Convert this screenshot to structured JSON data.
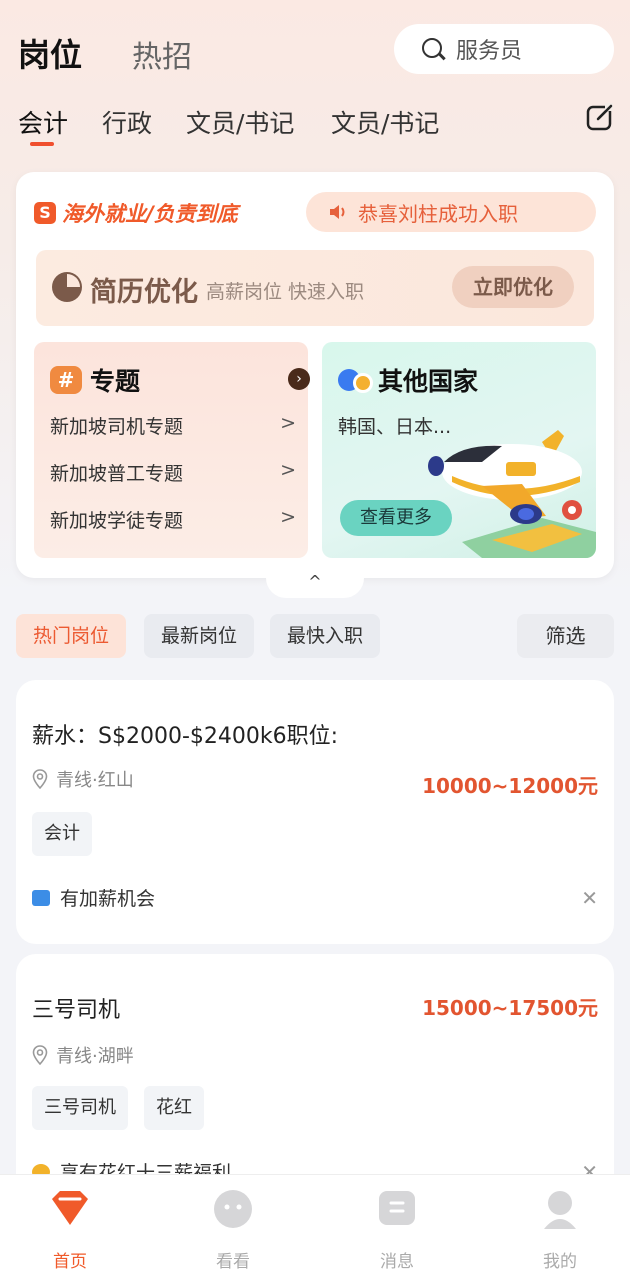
{
  "header": {
    "tab_positions": "岗位",
    "tab_hot": "热招",
    "search_placeholder": "服务员"
  },
  "categories": [
    "会计",
    "行政",
    "文员/书记",
    "文员/书记"
  ],
  "promo": {
    "brand": "海外就业/负责到底",
    "notice": "恭喜刘柱成功入职",
    "resume": {
      "title": "简历优化",
      "subtitle": "高薪岗位 快速入职",
      "button": "立即优化"
    },
    "topic": {
      "title": "专题",
      "items": [
        "新加坡司机专题",
        "新加坡普工专题",
        "新加坡学徒专题"
      ],
      "arrow": ">"
    },
    "country": {
      "title": "其他国家",
      "subtitle": "韩国、日本...",
      "button": "查看更多"
    },
    "collapse": "^"
  },
  "filters": {
    "chips": [
      "热门岗位",
      "最新岗位",
      "最快入职"
    ],
    "filter_button": "筛选"
  },
  "jobs": [
    {
      "title": "薪水：S$2000-$2400k6职位:",
      "location": "青线·红山",
      "salary": "10000~12000元",
      "tags": [
        "会计"
      ],
      "benefit": "有加薪机会"
    },
    {
      "title": "三号司机",
      "location": "青线·湖畔",
      "salary": "15000~17500元",
      "tags": [
        "三号司机",
        "花红"
      ],
      "benefit": "享有花红十三薪福利"
    }
  ],
  "tabbar": [
    "首页",
    "看看",
    "消息",
    "我的"
  ],
  "colors": {
    "accent": "#f05a2a",
    "salary": "#e25530",
    "active_chip_bg": "#fde3d8"
  }
}
